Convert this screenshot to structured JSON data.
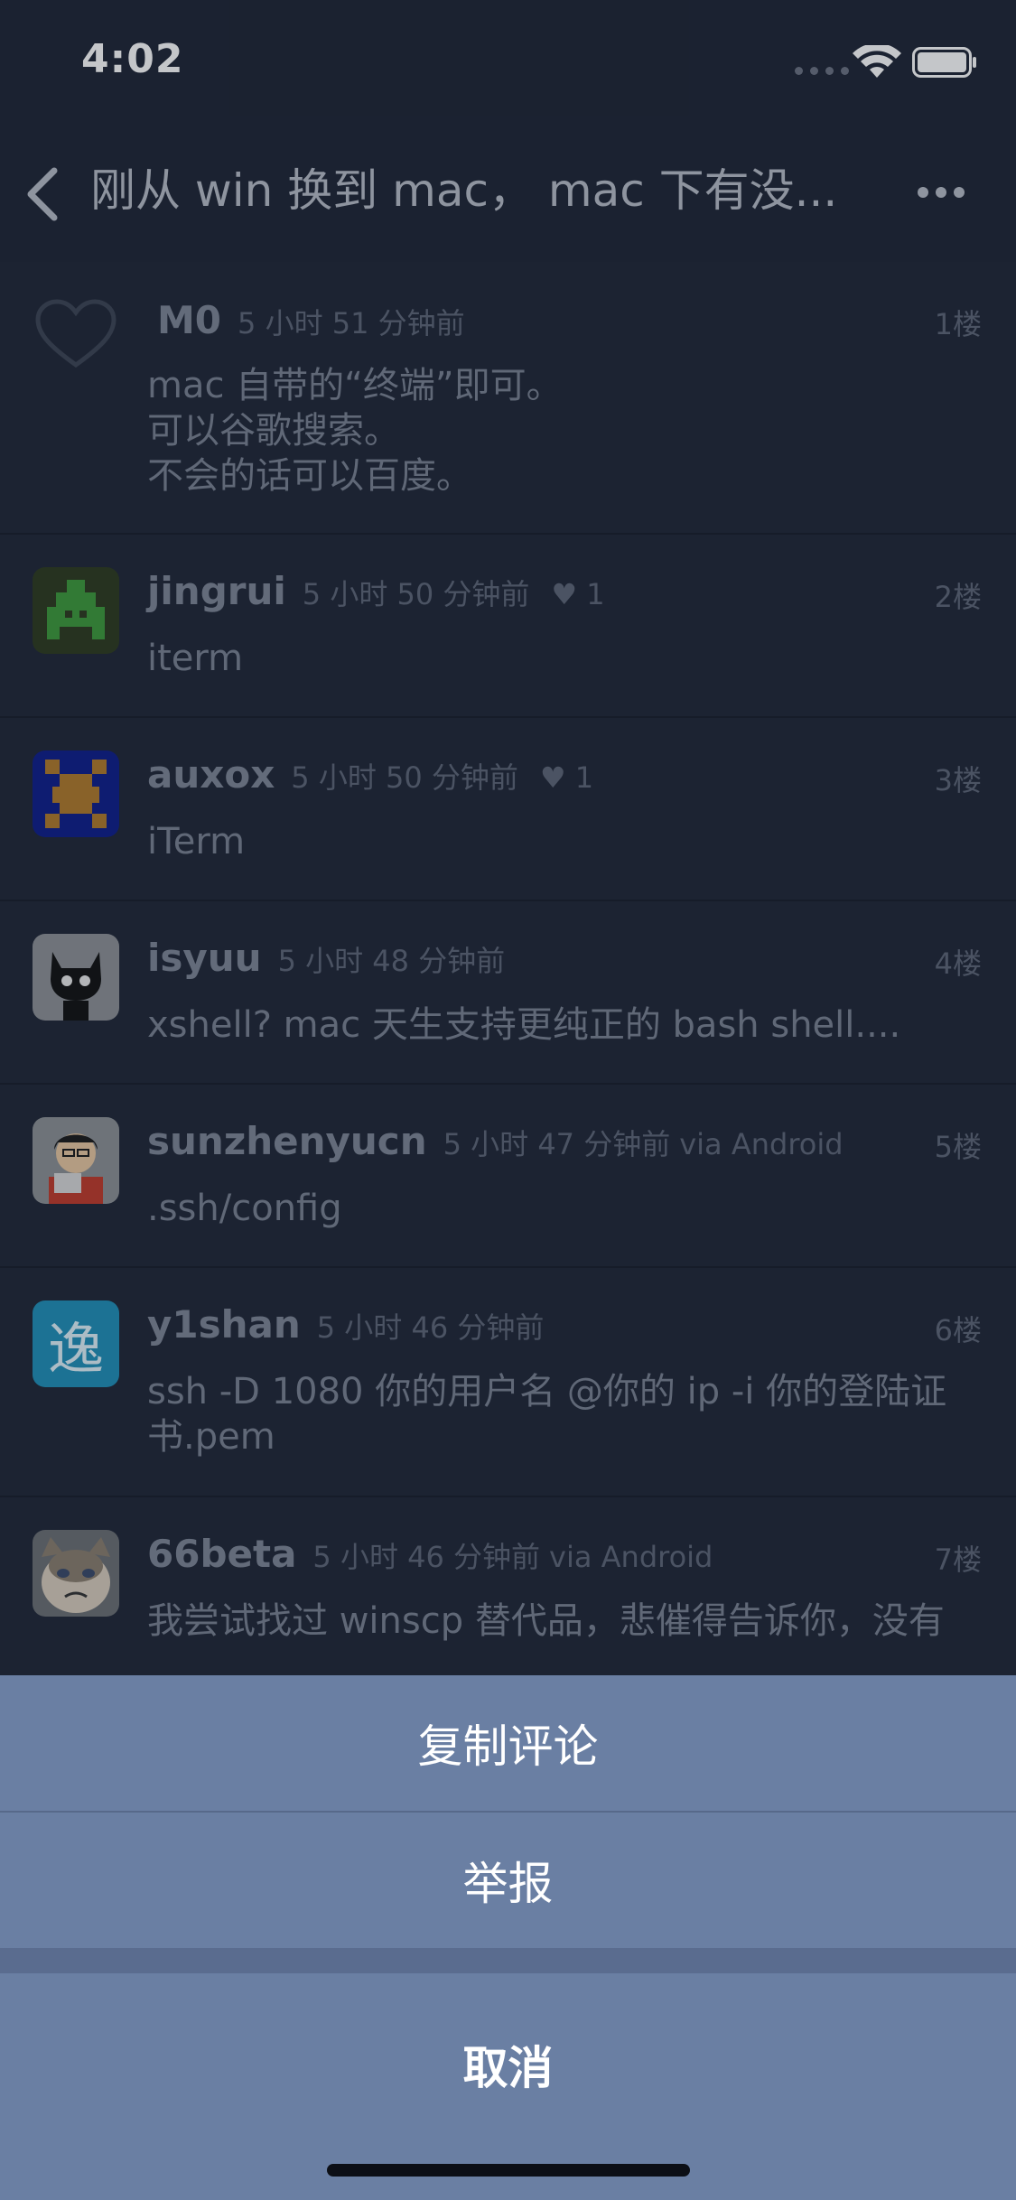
{
  "status": {
    "time": "4:02"
  },
  "nav": {
    "title": "刚从 win 换到 mac， mac 下有没..."
  },
  "comments": [
    {
      "user": "M0",
      "time": "5 小时 51 分钟前",
      "via": "",
      "likes": "",
      "floor": "1楼",
      "content": "mac 自带的“终端”即可。\n可以谷歌搜索。\n不会的话可以百度。",
      "avatar": "heart-outline-icon"
    },
    {
      "user": "jingrui",
      "time": "5 小时 50 分钟前",
      "via": "",
      "likes": "♥ 1",
      "floor": "2楼",
      "content": "iterm",
      "avatar": "pixel-invader-green"
    },
    {
      "user": "auxox",
      "time": "5 小时 50 分钟前",
      "via": "",
      "likes": "♥ 1",
      "floor": "3楼",
      "content": "iTerm",
      "avatar": "pixel-invader-blue"
    },
    {
      "user": "isyuu",
      "time": "5 小时 48 分钟前",
      "via": "",
      "likes": "",
      "floor": "4楼",
      "content": "xshell? mac 天生支持更纯正的 bash shell....",
      "avatar": "black-cat"
    },
    {
      "user": "sunzhenyucn",
      "time": "5 小时 47 分钟前",
      "via": "via Android",
      "likes": "",
      "floor": "5楼",
      "content": ".ssh/config",
      "avatar": "cartoon-man-laptop"
    },
    {
      "user": "y1shan",
      "time": "5 小时 46 分钟前",
      "via": "",
      "likes": "",
      "floor": "6楼",
      "content": "ssh -D 1080 你的用户名 @你的 ip -i 你的登陆证书.pem",
      "avatar": "chinese-character-yi",
      "avatar_text": "逸"
    },
    {
      "user": "66beta",
      "time": "5 小时 46 分钟前",
      "via": "via Android",
      "likes": "",
      "floor": "7楼",
      "content": "我尝试找过 winscp 替代品，悲催得告诉你，没有",
      "avatar": "grumpy-cat"
    }
  ],
  "action_sheet": {
    "copy_label": "复制评论",
    "report_label": "举报",
    "cancel_label": "取消"
  },
  "colors": {
    "background": "#1f2636",
    "sheet_button": "#6a7fa3",
    "text_primary": "#ffffff"
  }
}
